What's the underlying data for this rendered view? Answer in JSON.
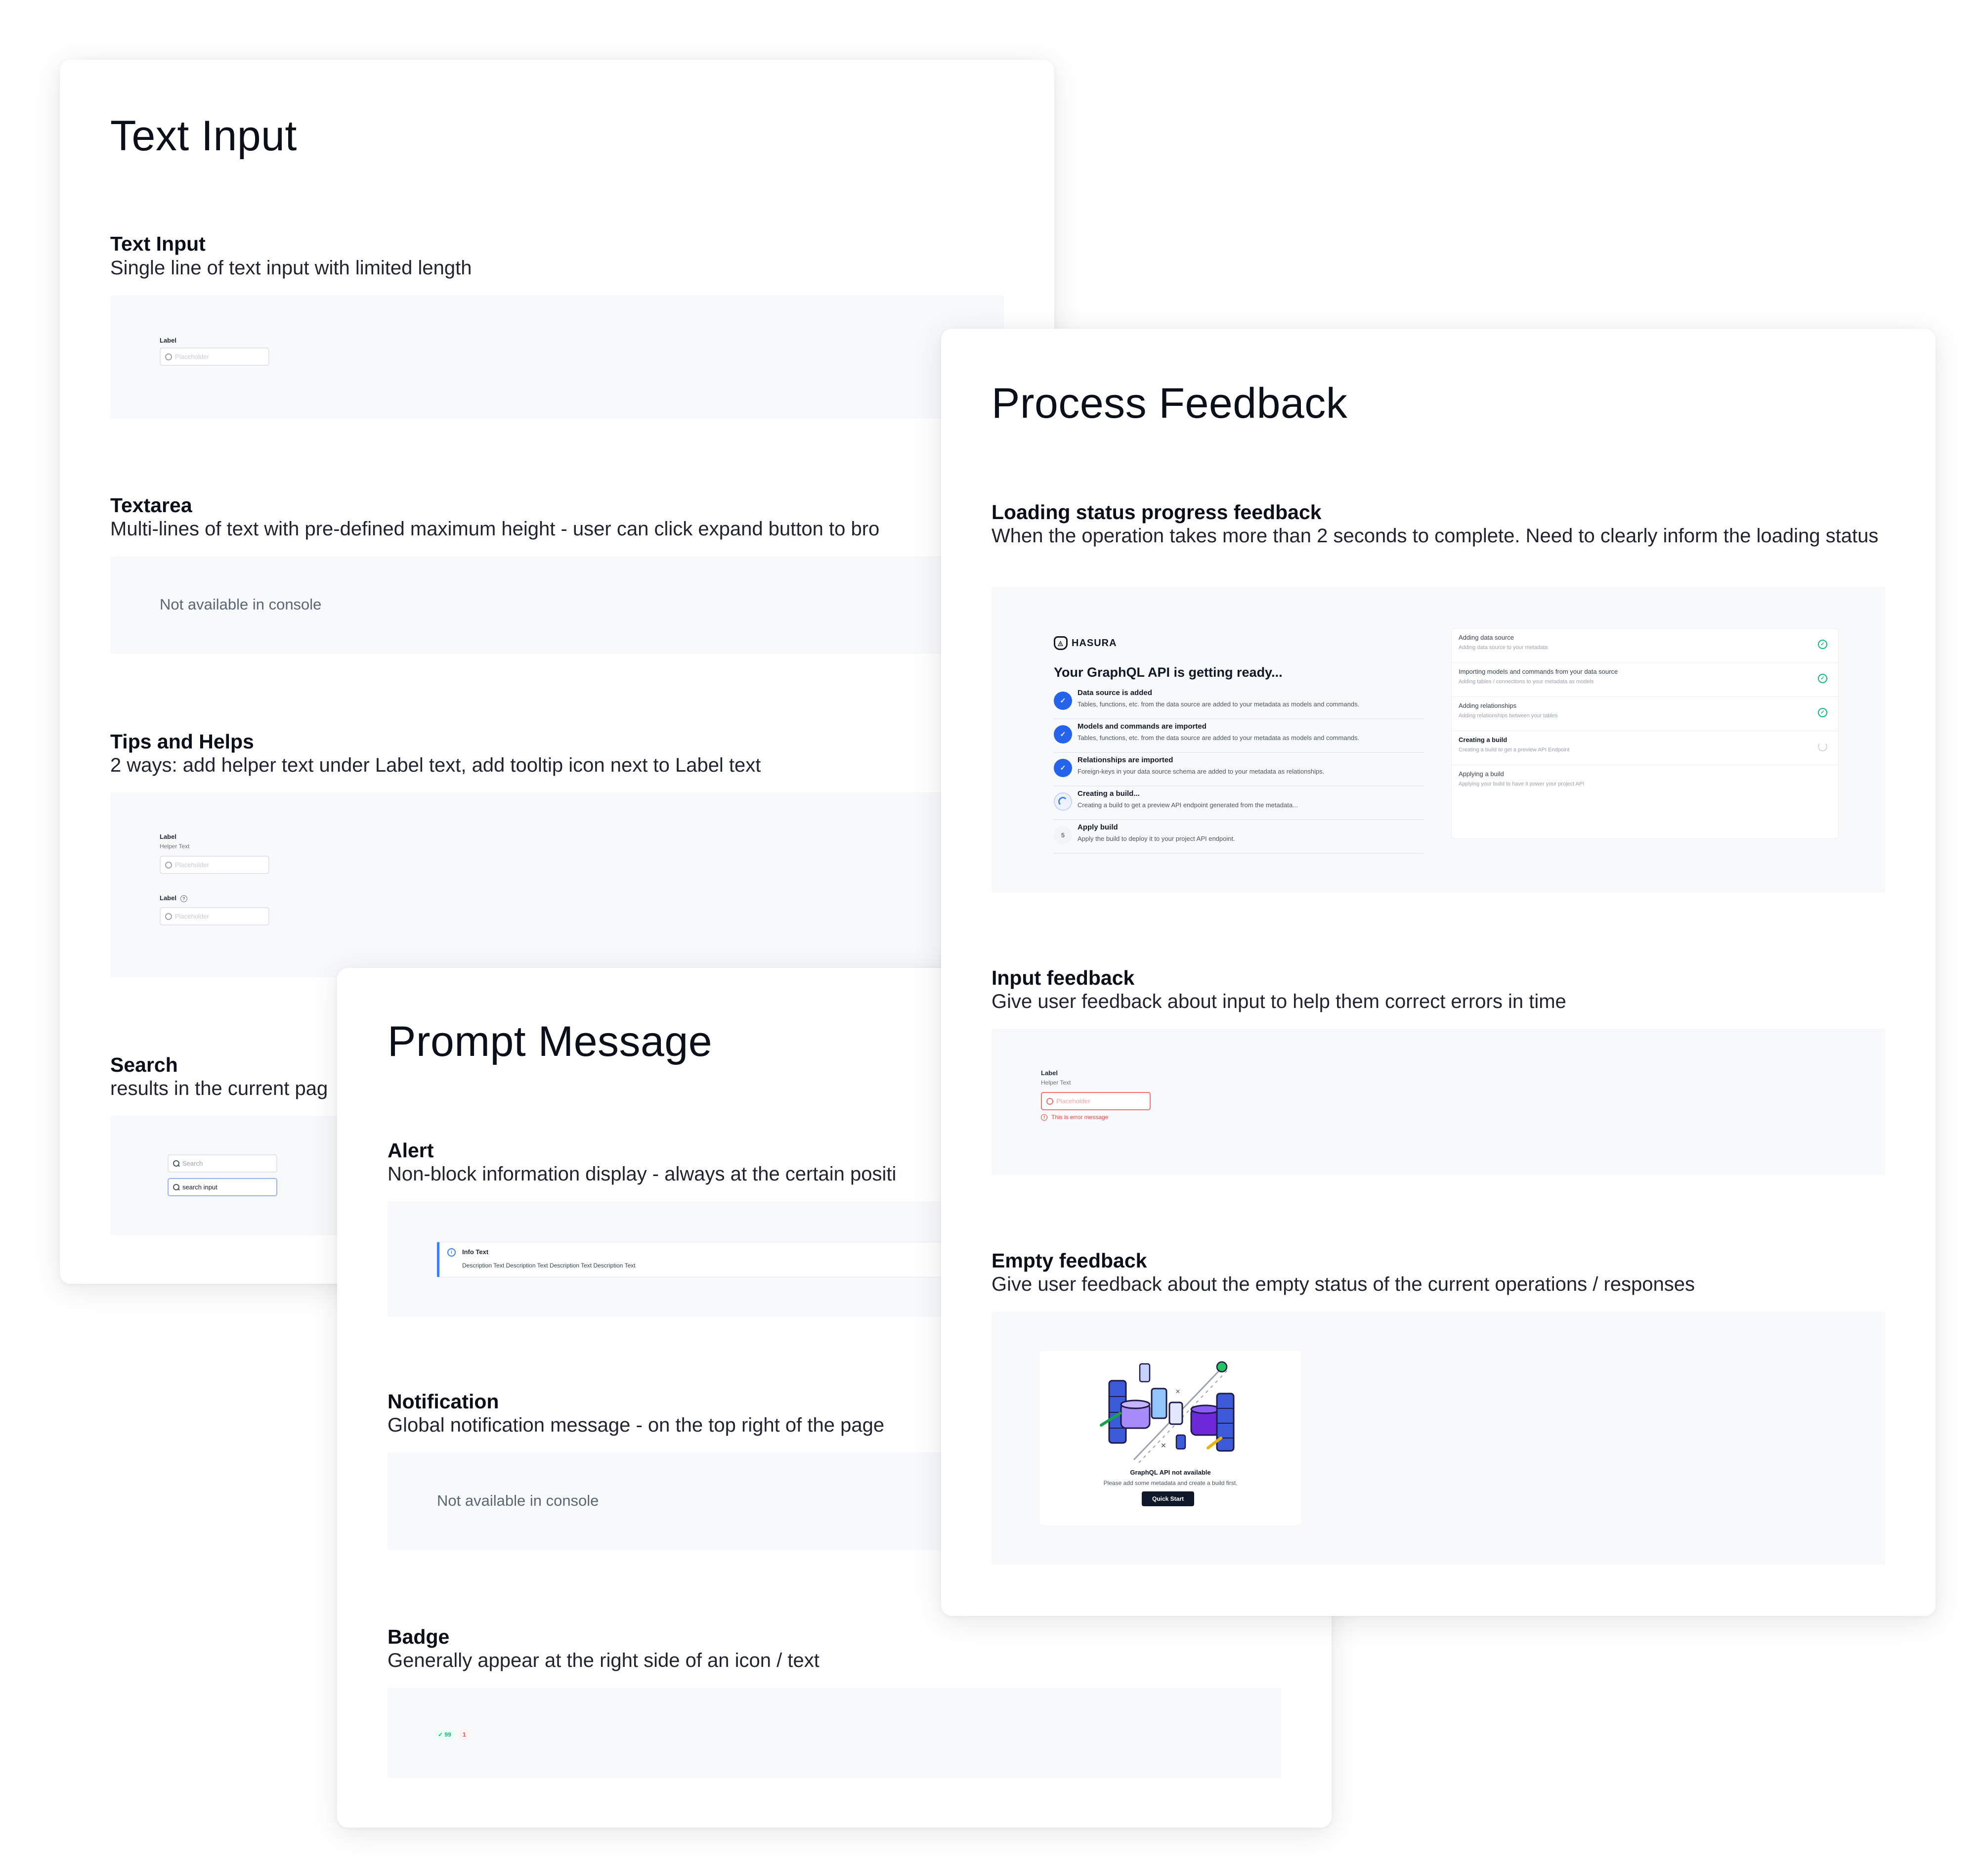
{
  "text_input_card": {
    "title": "Text Input",
    "sections": {
      "text_input": {
        "title": "Text Input",
        "desc": "Single line of text input with limited length",
        "label": "Label",
        "placeholder": "Placeholder"
      },
      "textarea": {
        "title": "Textarea",
        "desc": "Multi-lines of text with pre-defined maximum height - user can click expand button to bro",
        "na": "Not available in console"
      },
      "tips": {
        "title": "Tips and Helps",
        "desc": "2 ways: add helper text under Label text, add tooltip icon next to Label text",
        "label1": "Label",
        "helper": "Helper Text",
        "placeholder1": "Placeholder",
        "label2": "Label",
        "placeholder2": "Placeholder"
      },
      "search": {
        "title": "Search",
        "desc": "results in the current pag",
        "placeholder": "Search",
        "value": "search input"
      }
    }
  },
  "prompt_card": {
    "title": "Prompt Message",
    "sections": {
      "alert": {
        "title": "Alert",
        "desc": "Non-block information display - always at the certain positi",
        "alert_title": "Info Text",
        "alert_desc": "Description Text Description Text Description Text Description Text"
      },
      "notification": {
        "title": "Notification",
        "desc": "Global notification message - on the top right of the page",
        "na": "Not available in console"
      },
      "badge": {
        "title": "Badge",
        "desc": "Generally appear at the right side of an icon / text",
        "badge_green": "✓ 99",
        "badge_red": "1"
      }
    }
  },
  "process_card": {
    "title": "Process Feedback",
    "loading": {
      "title": "Loading status progress feedback",
      "desc": "When the operation takes more than 2 seconds to complete. Need to clearly inform the loading status",
      "brand": "HASURA",
      "heading": "Your GraphQL API is getting ready...",
      "steps": [
        {
          "title": "Data source is added",
          "desc": "Tables, functions, etc. from the data source are added to your metadata as models and commands.",
          "state": "done"
        },
        {
          "title": "Models and commands are imported",
          "desc": "Tables, functions, etc. from the data source are added to your metadata as models and commands.",
          "state": "done"
        },
        {
          "title": "Relationships are imported",
          "desc": "Foreign-keys in your data source schema are added to your metadata as relationships.",
          "state": "done"
        },
        {
          "title": "Creating a build...",
          "desc": "Creating a build to get a preview API endpoint generated from the metadata...",
          "state": "loading"
        },
        {
          "title": "Apply build",
          "desc": "Apply the build to deploy it to your project API endpoint.",
          "state": "pending",
          "num": "5"
        }
      ],
      "list": [
        {
          "title": "Adding data source",
          "desc": "Adding data source to your metadata",
          "state": "done"
        },
        {
          "title": "Importing models and commands from your data source",
          "desc": "Adding tables / connections to your metadata as models",
          "state": "done"
        },
        {
          "title": "Adding relationships",
          "desc": "Adding relationships between your tables",
          "state": "done"
        },
        {
          "title": "Creating a build",
          "desc": "Creating a build to get a preview API Endpoint",
          "state": "loading"
        },
        {
          "title": "Applying a build",
          "desc": "Applying your build to have it power your project API",
          "state": "pending"
        }
      ]
    },
    "input_feedback": {
      "title": "Input feedback",
      "desc": "Give user feedback about input to help them correct errors in time",
      "label": "Label",
      "helper": "Helper Text",
      "placeholder": "Placeholder",
      "error": "This is error message"
    },
    "empty_feedback": {
      "title": "Empty feedback",
      "desc": "Give user feedback about the empty status of the current operations / responses",
      "empty_title": "GraphQL API not available",
      "empty_desc": "Please add some metadata and create a build first.",
      "button": "Quick Start"
    }
  }
}
